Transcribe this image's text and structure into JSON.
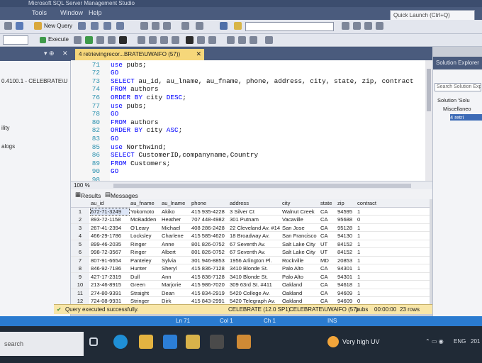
{
  "window": {
    "title": "Microsoft SQL Server Management Studio",
    "quick_launch_placeholder": "Quick Launch (Ctrl+Q)"
  },
  "menu": [
    "Window",
    "Help",
    "Tools"
  ],
  "toolbar": {
    "new_query_label": "New Query",
    "execute_label": "Execute"
  },
  "object_explorer": {
    "server_line": "0.4100.1 - CELEBRATE\\U",
    "items": [
      "ility",
      "alogs"
    ]
  },
  "doc_tab": {
    "label": "4 retrievingrecor...BRATE\\UWAIFO (57))"
  },
  "editor": {
    "lines": [
      {
        "n": "71",
        "parts": [
          {
            "t": "use",
            "k": true
          },
          {
            "t": " pubs;"
          }
        ]
      },
      {
        "n": "72",
        "parts": [
          {
            "t": "GO",
            "k": true
          }
        ]
      },
      {
        "n": "73",
        "parts": [
          {
            "t": "SELECT",
            "k": true
          },
          {
            "t": " au_id, au_lname, au_fname, phone, address, city, state, zip, contract"
          }
        ]
      },
      {
        "n": "74",
        "parts": [
          {
            "t": "FROM",
            "k": true
          },
          {
            "t": " authors"
          }
        ]
      },
      {
        "n": "76",
        "parts": [
          {
            "t": "ORDER BY",
            "k": true
          },
          {
            "t": " city "
          },
          {
            "t": "DESC",
            "k": true
          },
          {
            "t": ";"
          }
        ]
      },
      {
        "n": "77",
        "parts": [
          {
            "t": "use",
            "k": true
          },
          {
            "t": " pubs;"
          }
        ]
      },
      {
        "n": "78",
        "parts": [
          {
            "t": "GO",
            "k": true
          }
        ]
      },
      {
        "n": "80",
        "parts": [
          {
            "t": "FROM",
            "k": true
          },
          {
            "t": " authors"
          }
        ]
      },
      {
        "n": "82",
        "parts": [
          {
            "t": "ORDER BY",
            "k": true
          },
          {
            "t": " city "
          },
          {
            "t": "ASC",
            "k": true
          },
          {
            "t": ";"
          }
        ]
      },
      {
        "n": "83",
        "parts": [
          {
            "t": "GO",
            "k": true
          }
        ]
      },
      {
        "n": "85",
        "parts": [
          {
            "t": "use",
            "k": true
          },
          {
            "t": " Northwind;"
          }
        ]
      },
      {
        "n": "86",
        "parts": [
          {
            "t": "SELECT",
            "k": true
          },
          {
            "t": " CustomerID,companyname,Country"
          }
        ]
      },
      {
        "n": "89",
        "parts": [
          {
            "t": "FROM",
            "k": true
          },
          {
            "t": " Customers;"
          }
        ]
      },
      {
        "n": "90",
        "parts": [
          {
            "t": "GO",
            "k": true
          }
        ]
      },
      {
        "n": "98",
        "parts": [
          {
            "t": ""
          }
        ]
      }
    ]
  },
  "zoom": "100 %",
  "results_tabs": [
    "Results",
    "Messages"
  ],
  "grid": {
    "columns": [
      "au_id",
      "au_fname",
      "au_lname",
      "phone",
      "address",
      "city",
      "state",
      "zip",
      "contract"
    ],
    "rows": [
      [
        "1",
        "672-71-3249",
        "Yokomoto",
        "Akiko",
        "415 935-4228",
        "3 Silver Ct",
        "Walnut Creek",
        "CA",
        "94595",
        "1"
      ],
      [
        "2",
        "893-72-1158",
        "McBadden",
        "Heather",
        "707 448-4982",
        "301 Putnam",
        "Vacaville",
        "CA",
        "95688",
        "0"
      ],
      [
        "3",
        "267-41-2394",
        "O'Leary",
        "Michael",
        "408 286-2428",
        "22 Cleveland Av. #14",
        "San Jose",
        "CA",
        "95128",
        "1"
      ],
      [
        "4",
        "466-29-1786",
        "Locksley",
        "Charlene",
        "415 585-4620",
        "18 Broadway Av.",
        "San Francisco",
        "CA",
        "94130",
        "1"
      ],
      [
        "5",
        "899-46-2035",
        "Ringer",
        "Anne",
        "801 826-0752",
        "67 Seventh Av.",
        "Salt Lake City",
        "UT",
        "84152",
        "1"
      ],
      [
        "6",
        "998-72-3567",
        "Ringer",
        "Albert",
        "801 826-0752",
        "67 Seventh Av.",
        "Salt Lake City",
        "UT",
        "84152",
        "1"
      ],
      [
        "7",
        "807-91-6654",
        "Panteley",
        "Sylvia",
        "301 946-8853",
        "1956 Arlington Pl.",
        "Rockville",
        "MD",
        "20853",
        "1"
      ],
      [
        "8",
        "846-92-7186",
        "Hunter",
        "Sheryl",
        "415 836-7128",
        "3410 Blonde St.",
        "Palo Alto",
        "CA",
        "94301",
        "1"
      ],
      [
        "9",
        "427-17-2319",
        "Dull",
        "Ann",
        "415 836-7128",
        "3410 Blonde St.",
        "Palo Alto",
        "CA",
        "94301",
        "1"
      ],
      [
        "10",
        "213-46-8915",
        "Green",
        "Marjorie",
        "415 986-7020",
        "309 63rd St. #411",
        "Oakland",
        "CA",
        "94618",
        "1"
      ],
      [
        "11",
        "274-80-9391",
        "Straight",
        "Dean",
        "415 834-2919",
        "5420 College Av.",
        "Oakland",
        "CA",
        "94609",
        "1"
      ],
      [
        "12",
        "724-08-9931",
        "Stringer",
        "Dirk",
        "415 843-2991",
        "5420 Telegraph Av.",
        "Oakland",
        "CA",
        "94609",
        "0"
      ]
    ]
  },
  "query_status": {
    "message": "Query executed successfully.",
    "server": "CELEBRATE (12.0 SP1)",
    "user": "CELEBRATE\\UWAIFO (57)",
    "db": "pubs",
    "time": "00:00:00",
    "rows": "23 rows"
  },
  "solution_explorer": {
    "title": "Solution Explorer",
    "search_placeholder": "Search Solution Expl",
    "items": [
      "Solution 'Solu",
      "Miscellaneo",
      "4 retri"
    ]
  },
  "status_bar": {
    "ln": "Ln 71",
    "col": "Col 1",
    "ch": "Ch 1",
    "ins": "INS"
  },
  "taskbar": {
    "search_text": "search",
    "weather": "Very high UV",
    "lang": "ENG",
    "time": "201"
  },
  "colors": {
    "keyword": "#0000ff",
    "line_number": "#2b91af",
    "status_bar": "#2a7bd0",
    "tab_active": "#f6d77a"
  }
}
